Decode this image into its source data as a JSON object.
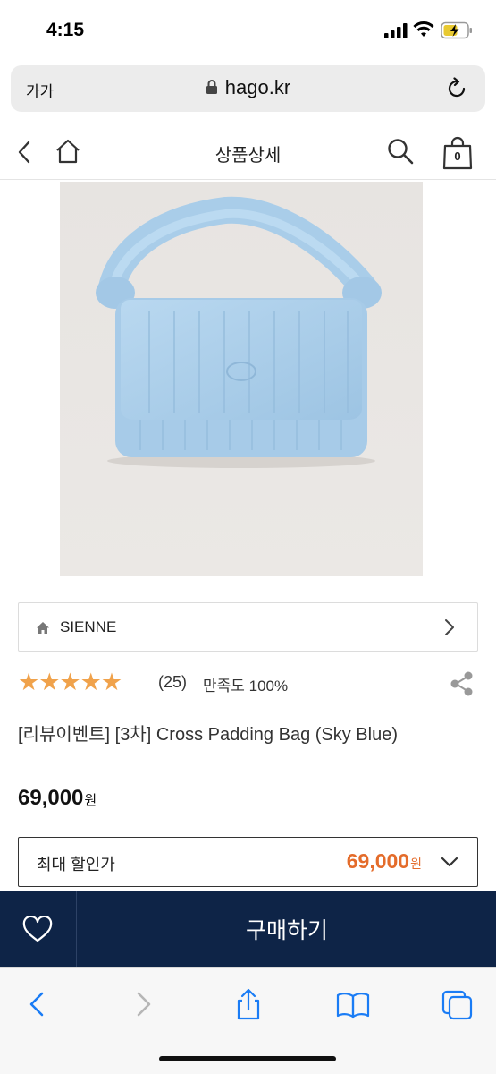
{
  "status_bar": {
    "time": "4:15"
  },
  "browser": {
    "text_size_label": "가가",
    "url": "hago.kr"
  },
  "header": {
    "title": "상품상세",
    "cart_count": "0"
  },
  "product": {
    "image_alt_icon": "sky-blue-quilted-padding-bag",
    "brand": "SIENNE",
    "stars": "★★★★★",
    "review_count": "(25)",
    "satisfaction": "만족도 100%",
    "name": "[리뷰이벤트] [3차] Cross Padding Bag (Sky Blue)",
    "price": "69,000",
    "currency": "원"
  },
  "discount": {
    "label": "최대 할인가",
    "price": "69,000",
    "currency": "원"
  },
  "buy_bar": {
    "buy_label": "구매하기"
  },
  "colors": {
    "accent_orange": "#e46c2b",
    "star_color": "#f0a24b",
    "buy_bar_bg": "#0e2447",
    "product_blue": "#a9cde9"
  }
}
